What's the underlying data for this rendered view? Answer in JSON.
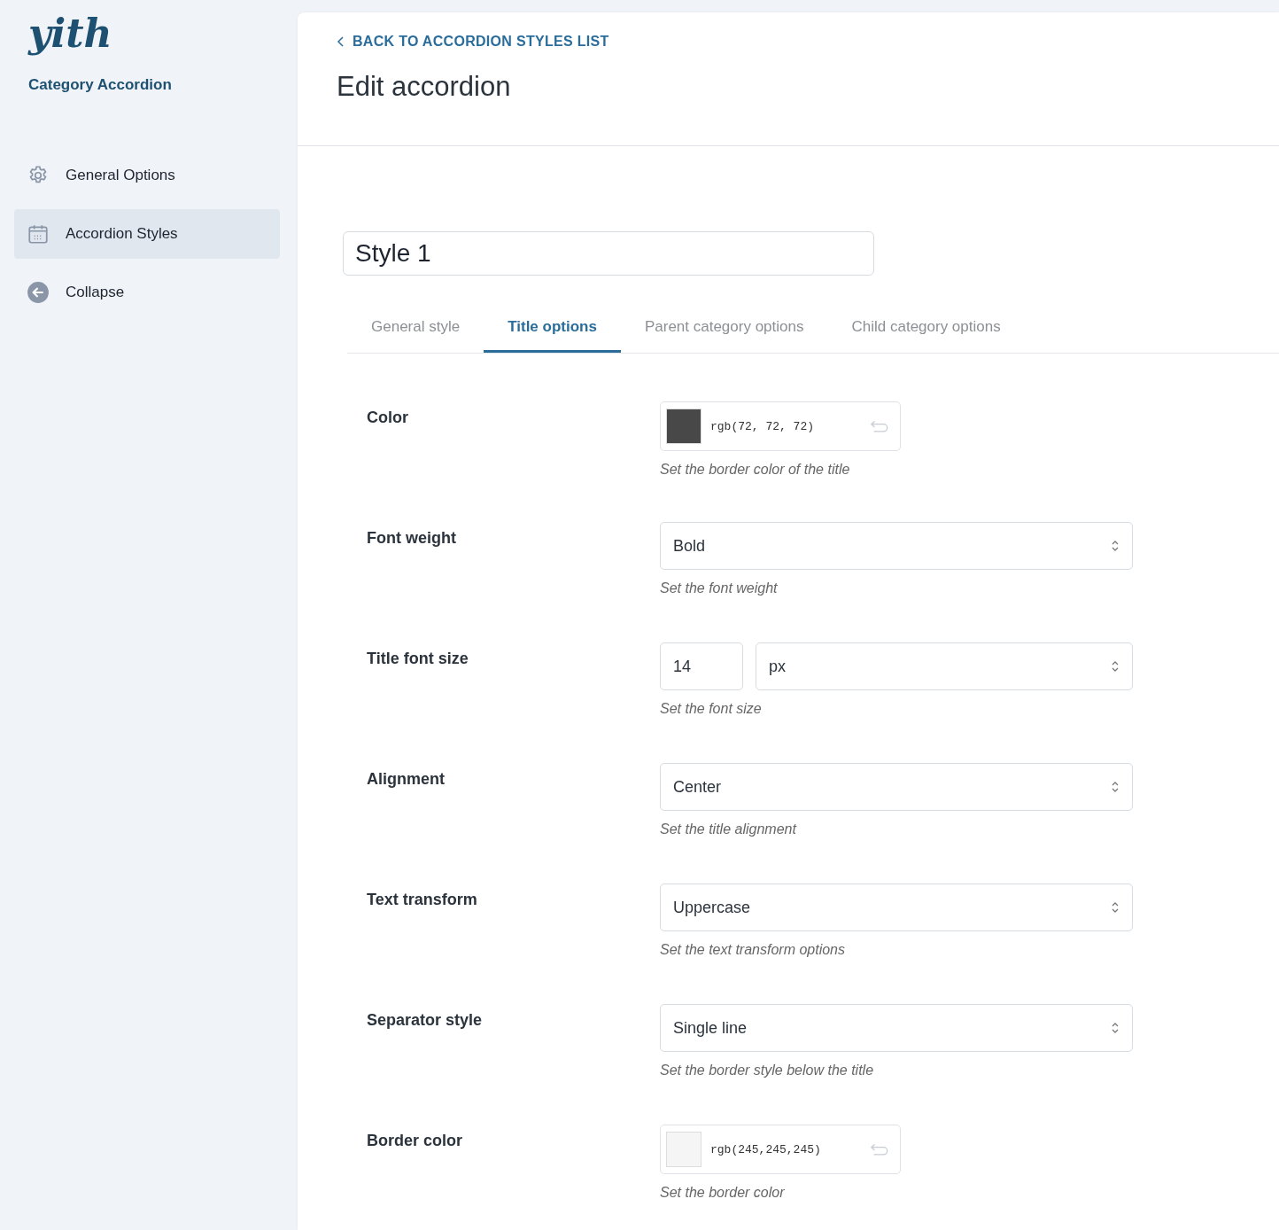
{
  "sidebar": {
    "logo": "yith",
    "plugin_name": "Category Accordion",
    "items": [
      {
        "label": "General Options",
        "selected": false
      },
      {
        "label": "Accordion Styles",
        "selected": true
      },
      {
        "label": "Collapse",
        "selected": false
      }
    ]
  },
  "header": {
    "back_link": "BACK TO ACCORDION STYLES LIST",
    "title": "Edit accordion"
  },
  "style_name": {
    "value": "Style 1"
  },
  "tabs": [
    {
      "label": "General style",
      "selected": false
    },
    {
      "label": "Title options",
      "selected": true
    },
    {
      "label": "Parent category options",
      "selected": false
    },
    {
      "label": "Child category options",
      "selected": false
    }
  ],
  "options": [
    {
      "kind": "color",
      "label": "Color",
      "value": "rgb(72, 72, 72)",
      "description": "Set the border color of the title"
    },
    {
      "kind": "select",
      "label": "Font weight",
      "value": "Bold",
      "description": "Set the font weight"
    },
    {
      "kind": "number_unit",
      "label": "Title font size",
      "value": "14",
      "unit": "px",
      "description": "Set the font size"
    },
    {
      "kind": "select",
      "label": "Alignment",
      "value": "Center",
      "description": "Set the title alignment"
    },
    {
      "kind": "select",
      "label": "Text transform",
      "value": "Uppercase",
      "description": "Set the text transform options"
    },
    {
      "kind": "select",
      "label": "Separator style",
      "value": "Single line",
      "description": "Set the border style below the title"
    },
    {
      "kind": "color",
      "label": "Border color",
      "value": "rgb(245,245,245)",
      "description": "Set the border color"
    }
  ]
}
